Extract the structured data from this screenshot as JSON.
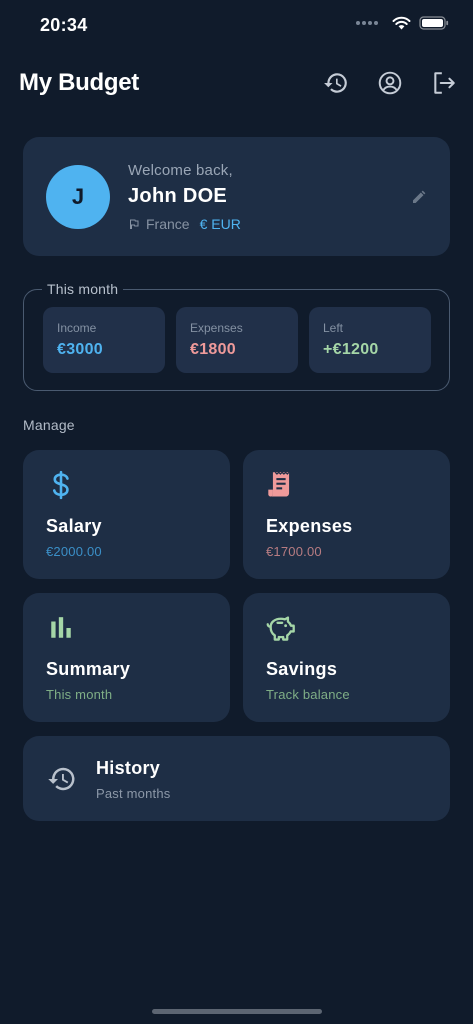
{
  "status_bar": {
    "time": "20:34"
  },
  "header": {
    "title": "My Budget",
    "icons": [
      "history-icon",
      "account-icon",
      "logout-icon"
    ]
  },
  "profile": {
    "avatar_initial": "J",
    "welcome": "Welcome back,",
    "name": "John DOE",
    "country": "France",
    "currency": "€ EUR"
  },
  "month": {
    "label": "This month",
    "income_label": "Income",
    "income_value": "€3000",
    "expenses_label": "Expenses",
    "expenses_value": "€1800",
    "left_label": "Left",
    "left_value": "+€1200"
  },
  "manage": {
    "label": "Manage",
    "salary": {
      "title": "Salary",
      "subtitle": "€2000.00"
    },
    "expenses": {
      "title": "Expenses",
      "subtitle": "€1700.00"
    },
    "summary": {
      "title": "Summary",
      "subtitle": "This month"
    },
    "savings": {
      "title": "Savings",
      "subtitle": "Track balance"
    },
    "history": {
      "title": "History",
      "subtitle": "Past months"
    }
  },
  "colors": {
    "background": "#101b2b",
    "card": "#1e2e45",
    "accent_blue": "#4fb3f0",
    "expense_red": "#ef9a9a",
    "positive_green": "#a5d6a7"
  }
}
